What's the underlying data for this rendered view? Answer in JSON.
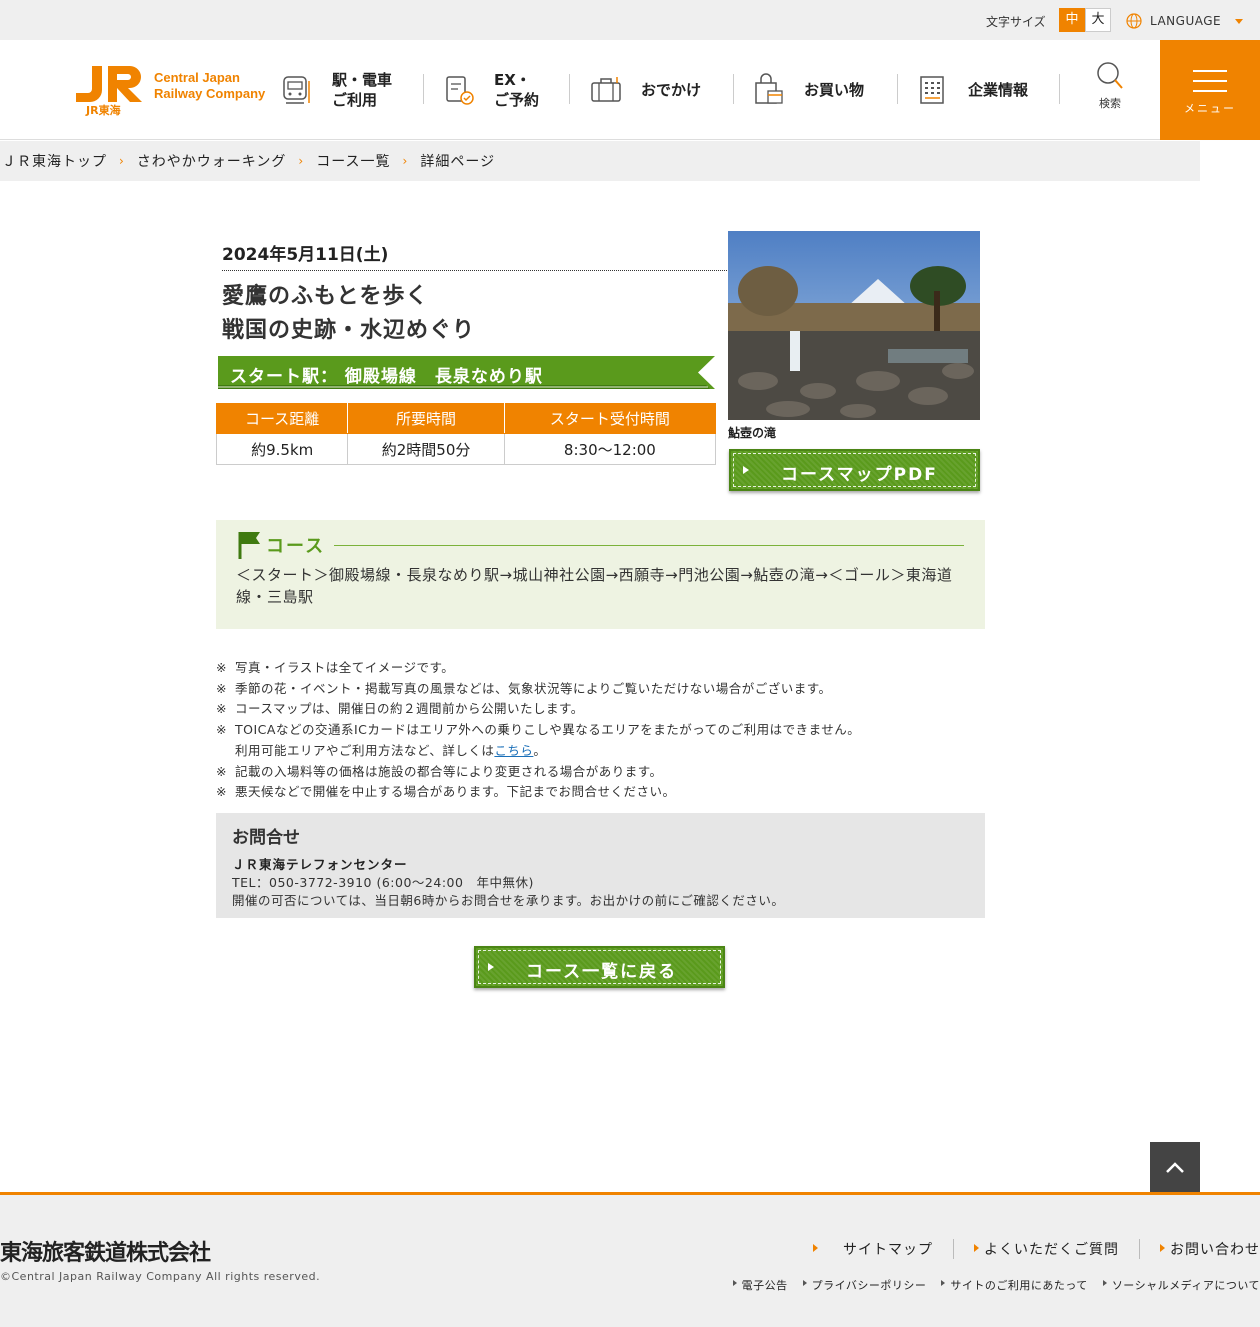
{
  "util": {
    "font_size_label": "文字サイズ",
    "font_mid": "中",
    "font_big": "大",
    "language": "LANGUAGE"
  },
  "header": {
    "logo_text_1": "Central Japan",
    "logo_text_2": "Railway Company",
    "logo_jr_label": "JR東海",
    "nav": [
      {
        "line1": "駅・電車",
        "line2": "ご利用"
      },
      {
        "line1": "EX・",
        "line2": "ご予約"
      },
      {
        "line1": "おでかけ",
        "line2": ""
      },
      {
        "line1": "お買い物",
        "line2": ""
      },
      {
        "line1": "企業情報",
        "line2": ""
      }
    ],
    "search_label": "検索",
    "menu_label": "メニュー"
  },
  "breadcrumb": [
    "ＪＲ東海トップ",
    "さわやかウォーキング",
    "コース一覧",
    "詳細ページ"
  ],
  "event": {
    "date": "2024年5月11日(土)",
    "title_line1": "愛鷹のふもとを歩く",
    "title_line2": "戦国の史跡・水辺めぐり",
    "start_station": "スタート駅： 御殿場線　長泉なめり駅",
    "table_headers": [
      "コース距離",
      "所要時間",
      "スタート受付時間"
    ],
    "table_values": [
      "約9.5km",
      "約2時間50分",
      "8:30～12:00"
    ],
    "photo_caption": "鮎壺の滝",
    "pdf_button": "コースマップPDF"
  },
  "course": {
    "heading": "コース",
    "route": "＜スタート＞御殿場線・長泉なめり駅→城山神社公園→西願寺→門池公園→鮎壺の滝→＜ゴール＞東海道線・三島駅"
  },
  "notes": {
    "mark": "※",
    "n1": "写真・イラストは全てイメージです。",
    "n2": "季節の花・イベント・掲載写真の風景などは、気象状況等によりご覧いただけない場合がございます。",
    "n3": "コースマップは、開催日の約２週間前から公開いたします。",
    "n4": "TOICAなどの交通系ICカードはエリア外への乗りこしや異なるエリアをまたがってのご利用はできません。",
    "n4b_pre": "利用可能エリアやご利用方法など、詳しくは",
    "n4b_link": "こちら",
    "n4b_post": "。",
    "n5": "記載の入場料等の価格は施設の都合等により変更される場合があります。",
    "n6": "悪天候などで開催を中止する場合があります。下記までお問合せください。"
  },
  "contact": {
    "heading": "お問合せ",
    "center": "ＪＲ東海テレフォンセンター",
    "tel": "TEL：050-3772-3910 (6:00～24:00　年中無休)",
    "note": "開催の可否については、当日朝6時からお問合せを承ります。お出かけの前にご確認ください。"
  },
  "back_button": "コース一覧に戻る",
  "footer": {
    "corp_name": "東海旅客鉄道株式会社",
    "copyright": "©Central Japan Railway Company All rights reserved.",
    "links_main": [
      "サイトマップ",
      "よくいただくご質問",
      "お問い合わせ"
    ],
    "links_sub": [
      "電子公告",
      "プライバシーポリシー",
      "サイトのご利用にあたって",
      "ソーシャルメディアについて"
    ]
  },
  "colors": {
    "brand_orange": "#f08300",
    "walk_green": "#5a9a1c",
    "course_bg": "#eef3e2"
  }
}
